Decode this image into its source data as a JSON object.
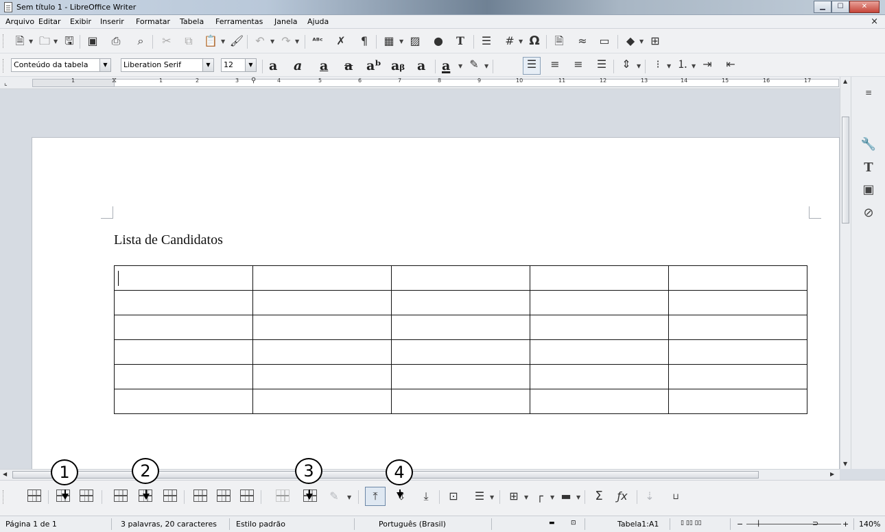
{
  "window": {
    "title": "Sem título 1 - LibreOffice Writer",
    "controls": {
      "minimize": "▁",
      "maximize": "☐",
      "close": "✕"
    }
  },
  "menu": {
    "items": [
      "Arquivo",
      "Editar",
      "Exibir",
      "Inserir",
      "Formatar",
      "Tabela",
      "Ferramentas",
      "Janela",
      "Ajuda"
    ],
    "close_label": "×"
  },
  "formatting": {
    "paragraph_style": "Conteúdo da tabela",
    "font_name": "Liberation Serif",
    "font_size": "12"
  },
  "ruler": {
    "numbers": [
      "1",
      "1",
      "2",
      "3",
      "4",
      "5",
      "6",
      "7",
      "8",
      "9",
      "10",
      "11",
      "12",
      "13",
      "14",
      "15",
      "16",
      "17"
    ]
  },
  "document": {
    "heading": "Lista de Candidatos",
    "table": {
      "rows": 6,
      "cols": 5
    }
  },
  "callouts": [
    "1",
    "2",
    "3",
    "4"
  ],
  "status": {
    "page": "Página 1 de 1",
    "words": "3 palavras, 20 caracteres",
    "style": "Estilo padrão",
    "language": "Português (Brasil)",
    "table_cell": "Tabela1:A1",
    "zoom": "140%",
    "zoom_minus": "−",
    "zoom_plus": "+"
  },
  "icons": {
    "toolbar1": [
      "new-document-icon",
      "open-icon",
      "save-icon",
      "export-pdf-icon",
      "print-icon",
      "print-preview-icon",
      "cut-icon",
      "copy-icon",
      "paste-icon",
      "clone-format-icon",
      "undo-icon",
      "redo-icon",
      "spellcheck-icon",
      "autocorrect-icon",
      "formatting-marks-icon",
      "insert-table-icon",
      "insert-image-icon",
      "insert-chart-icon",
      "text-box-icon",
      "page-break-icon",
      "field-icon",
      "special-character-icon",
      "hyperlink-icon",
      "footnote-icon",
      "comment-icon",
      "shapes-icon",
      "navigator-icon"
    ],
    "toolbar2": [
      "bold-icon",
      "italic-icon",
      "underline-icon",
      "strikethrough-icon",
      "superscript-icon",
      "subscript-icon",
      "shadow-icon",
      "font-color-icon",
      "highlight-icon",
      "align-left-icon",
      "align-center-icon",
      "align-right-icon",
      "justify-icon",
      "line-spacing-icon",
      "bullets-icon",
      "numbering-icon",
      "increase-indent-icon",
      "decrease-indent-icon"
    ],
    "sidebar": [
      "properties-icon",
      "styles-icon",
      "gallery-icon",
      "navigator-icon"
    ],
    "table_toolbar": [
      "table-properties-icon",
      "insert-rows-above-icon",
      "insert-rows-below-icon",
      "delete-rows-icon",
      "delete-columns-icon",
      "delete-table-icon",
      "merge-cells-icon",
      "split-cells-icon",
      "optimize-icon",
      "select-table-icon",
      "protect-cells-icon",
      "align-top-icon",
      "align-center-vertical-icon",
      "align-bottom-icon",
      "table-autoformat-icon",
      "number-format-icon",
      "borders-icon",
      "border-style-icon",
      "border-color-icon",
      "sum-icon",
      "formula-icon",
      "sort-icon",
      "caption-icon"
    ]
  }
}
